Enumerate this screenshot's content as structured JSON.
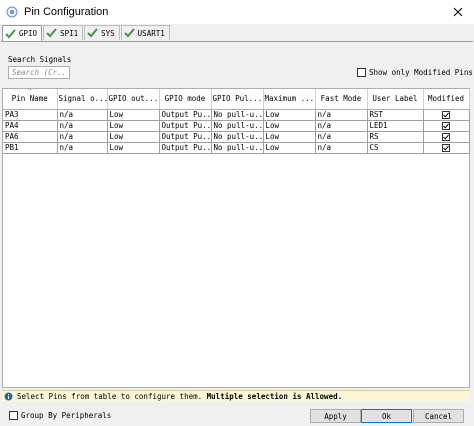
{
  "window": {
    "title": "Pin Configuration"
  },
  "tabs": [
    {
      "label": "GPIO",
      "active": true
    },
    {
      "label": "SPI1",
      "active": false
    },
    {
      "label": "SYS",
      "active": false
    },
    {
      "label": "USART1",
      "active": false
    }
  ],
  "search": {
    "label": "Search Signals",
    "placeholder": "Search (Cr..."
  },
  "show_modified": {
    "label": "Show only Modified Pins",
    "checked": false
  },
  "table": {
    "columns": [
      "Pin Name",
      "Signal o...",
      "GPIO out...",
      "GPIO mode",
      "GPIO Pul...",
      "Maximum ...",
      "Fast Mode",
      "User Label",
      "Modified"
    ],
    "rows": [
      {
        "pin": "PA3",
        "signal": "n/a",
        "output": "Low",
        "mode": "Output Pu...",
        "pull": "No pull-u...",
        "speed": "Low",
        "fast": "n/a",
        "label": "RST",
        "modified": true
      },
      {
        "pin": "PA4",
        "signal": "n/a",
        "output": "Low",
        "mode": "Output Pu...",
        "pull": "No pull-u...",
        "speed": "Low",
        "fast": "n/a",
        "label": "LED1",
        "modified": true
      },
      {
        "pin": "PA6",
        "signal": "n/a",
        "output": "Low",
        "mode": "Output Pu...",
        "pull": "No pull-u...",
        "speed": "Low",
        "fast": "n/a",
        "label": "RS",
        "modified": true
      },
      {
        "pin": "PB1",
        "signal": "n/a",
        "output": "Low",
        "mode": "Output Pu...",
        "pull": "No pull-u...",
        "speed": "Low",
        "fast": "n/a",
        "label": "CS",
        "modified": true
      }
    ]
  },
  "status": {
    "text": "Select Pins from table to configure them.",
    "bold_text": "Multiple selection is Allowed."
  },
  "footer": {
    "group_label": "Group By Peripherals",
    "apply_label": "Apply",
    "ok_label": "Ok",
    "cancel_label": "Cancel"
  },
  "colors": {
    "check_green": "#3a9a3a",
    "status_bg": "#fbf7d6",
    "info_blue": "#1e66c8"
  }
}
